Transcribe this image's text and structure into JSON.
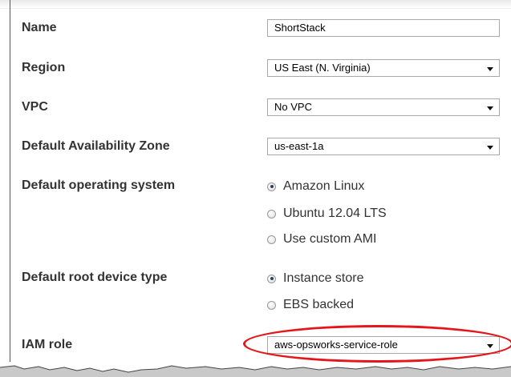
{
  "form": {
    "name": {
      "label": "Name",
      "value": "ShortStack"
    },
    "region": {
      "label": "Region",
      "value": "US East (N. Virginia)"
    },
    "vpc": {
      "label": "VPC",
      "value": "No VPC"
    },
    "availability_zone": {
      "label": "Default Availability Zone",
      "value": "us-east-1a"
    },
    "operating_system": {
      "label": "Default operating system",
      "options": [
        "Amazon Linux",
        "Ubuntu 12.04 LTS",
        "Use custom AMI"
      ],
      "selected": "Amazon Linux"
    },
    "root_device_type": {
      "label": "Default root device type",
      "options": [
        "Instance store",
        "EBS backed"
      ],
      "selected": "Instance store"
    },
    "iam_role": {
      "label": "IAM role",
      "value": "aws-opsworks-service-role"
    }
  },
  "colors": {
    "label_text": "#333333",
    "highlight_ring": "#e4161b",
    "field_border": "#a9a9a9"
  }
}
